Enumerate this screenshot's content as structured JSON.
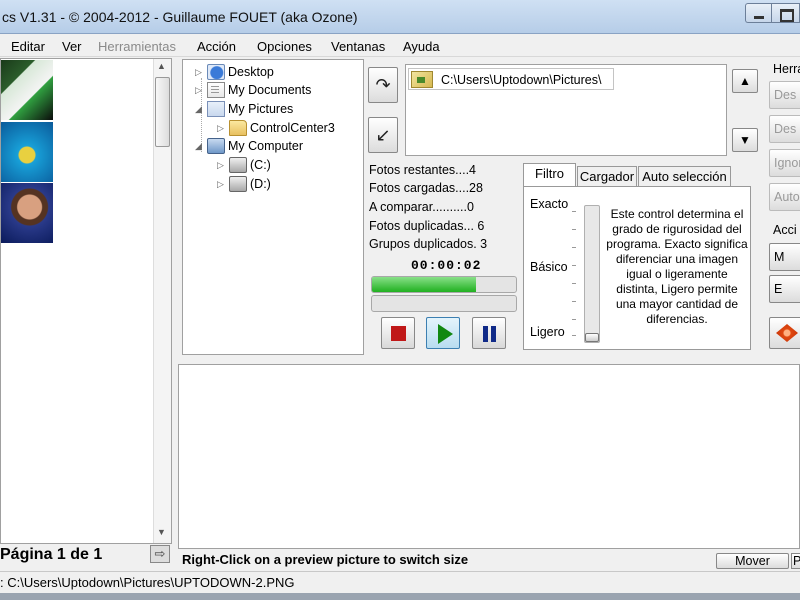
{
  "window": {
    "title": "cs V1.31 - © 2004-2012 - Guillaume FOUET (aka Ozone)"
  },
  "menu": {
    "items": [
      {
        "label": "Editar",
        "enabled": true
      },
      {
        "label": "Ver",
        "enabled": true
      },
      {
        "label": "Herramientas",
        "enabled": false
      },
      {
        "label": "Acción",
        "enabled": true
      },
      {
        "label": "Opciones",
        "enabled": true
      },
      {
        "label": "Ventanas",
        "enabled": true
      },
      {
        "label": "Ayuda",
        "enabled": true
      }
    ]
  },
  "thumbnails": {
    "page_label": "Página 1 de 1"
  },
  "tree": {
    "items": [
      {
        "label": "Desktop",
        "icon": "desktop-icon"
      },
      {
        "label": "My Documents",
        "icon": "documents-icon"
      },
      {
        "label": "My Pictures",
        "icon": "pictures-icon"
      },
      {
        "label": "ControlCenter3",
        "icon": "folder-icon"
      },
      {
        "label": "My Computer",
        "icon": "computer-icon"
      },
      {
        "label": "(C:)",
        "icon": "drive-icon"
      },
      {
        "label": "(D:)",
        "icon": "drive-icon"
      }
    ]
  },
  "paths": {
    "items": [
      "C:\\Users\\Uptodown\\Pictures\\"
    ]
  },
  "stats": {
    "remaining": "Fotos restantes....4",
    "loaded": "Fotos cargadas....28",
    "to_compare": "A comparar..........0",
    "duplicates": "Fotos duplicadas... 6",
    "groups": "Grupos duplicados. 3",
    "timer": "00:00:02",
    "progress_1": 0.72,
    "progress_2": 0
  },
  "tabs": {
    "items": [
      "Filtro",
      "Cargador",
      "Auto selección"
    ],
    "active": 0
  },
  "filter": {
    "levels": [
      "Exacto",
      "Básico",
      "Ligero"
    ],
    "description": "Este control determina el grado de rigurosidad del programa. Exacto significa diferenciar una imagen igual o ligeramente distinta, Ligero permite una mayor cantidad de diferencias.",
    "slider_value": 0
  },
  "right_panel": {
    "header": "Herra",
    "buttons": [
      {
        "label": "Des",
        "enabled": false
      },
      {
        "label": "Des",
        "enabled": false
      },
      {
        "label": "Ignora",
        "enabled": false
      },
      {
        "label": "Auto",
        "enabled": false
      }
    ],
    "section": "Acci",
    "action_buttons": [
      "M",
      "E"
    ]
  },
  "preview": {
    "hint": "Right-Click on a preview picture to switch size",
    "mover_label": "Mover",
    "extra_label": "P"
  },
  "status": {
    "text": ": C:\\Users\\Uptodown\\Pictures\\UPTODOWN-2.PNG"
  },
  "icons": {
    "up_arrow": "▲",
    "down_arrow": "▼",
    "next_page": "⇨"
  }
}
